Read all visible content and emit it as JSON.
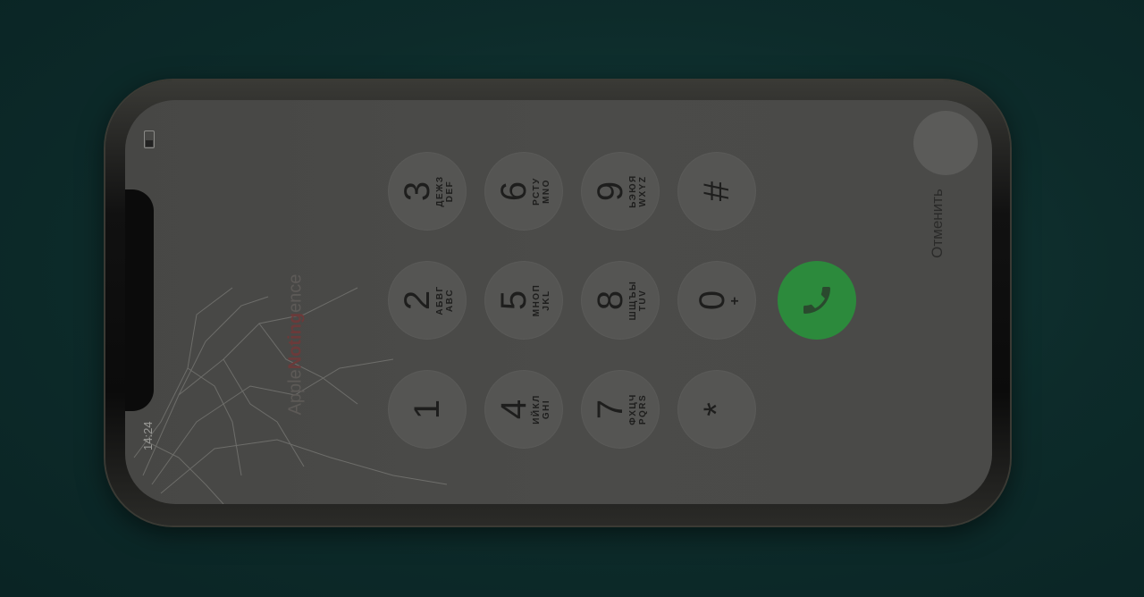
{
  "status_bar": {
    "time": "14:24"
  },
  "watermark": {
    "part1": "Apple",
    "part2": "Noting",
    "part3": "ence"
  },
  "dialpad": {
    "keys": [
      {
        "digit": "1",
        "letters": [
          "",
          ""
        ]
      },
      {
        "digit": "2",
        "letters": [
          "АБВГ",
          "ABC"
        ]
      },
      {
        "digit": "3",
        "letters": [
          "ДЕЖЗ",
          "DEF"
        ]
      },
      {
        "digit": "4",
        "letters": [
          "ИЙКЛ",
          "GHI"
        ]
      },
      {
        "digit": "5",
        "letters": [
          "МНОП",
          "JKL"
        ]
      },
      {
        "digit": "6",
        "letters": [
          "РСТУ",
          "MNO"
        ]
      },
      {
        "digit": "7",
        "letters": [
          "ФХЦЧ",
          "PQRS"
        ]
      },
      {
        "digit": "8",
        "letters": [
          "ШЩЪЫ",
          "TUV"
        ]
      },
      {
        "digit": "9",
        "letters": [
          "ЬЭЮЯ",
          "WXYZ"
        ]
      },
      {
        "digit": "*",
        "letters": [
          "",
          ""
        ]
      },
      {
        "digit": "0",
        "letters": [
          "+",
          ""
        ]
      },
      {
        "digit": "#",
        "letters": [
          "",
          ""
        ]
      }
    ]
  },
  "cancel_label": "Отменить",
  "icons": {
    "call": "phone-handset-icon",
    "battery": "battery-icon"
  },
  "colors": {
    "call_button": "#2c8a3c",
    "background": "#0d2b2a"
  }
}
